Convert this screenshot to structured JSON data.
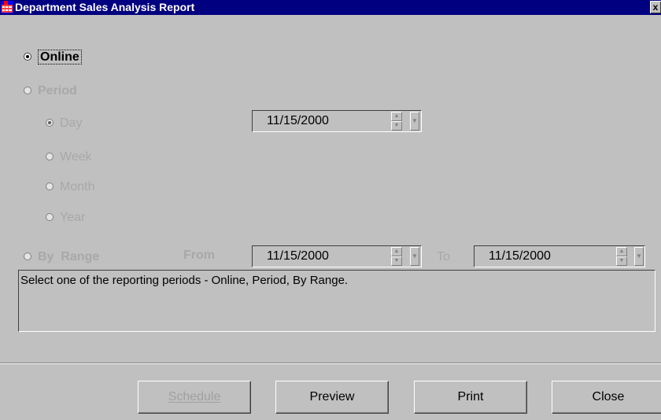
{
  "window": {
    "title": "Department Sales Analysis Report",
    "close_glyph": "x"
  },
  "options": {
    "online": "Online",
    "period": "Period",
    "day": "Day",
    "week": "Week",
    "month": "Month",
    "year": "Year",
    "by_range": "By  Range",
    "selected": "online",
    "period_selected": "day"
  },
  "fields": {
    "day_date": "11/15/2000",
    "from_label": "From",
    "from_date": "11/15/2000",
    "to_label": "To",
    "to_date": "11/15/2000"
  },
  "message": "Select one of the reporting periods - Online, Period, By Range.",
  "buttons": {
    "schedule": "Schedule",
    "preview": "Preview",
    "print": "Print",
    "close": "Close",
    "schedule_enabled": false
  },
  "icons": {
    "app": "report-grid-icon",
    "spin_up": "up-arrow-icon",
    "spin_down": "down-arrow-icon",
    "dropdown": "dropdown-arrow-icon"
  }
}
